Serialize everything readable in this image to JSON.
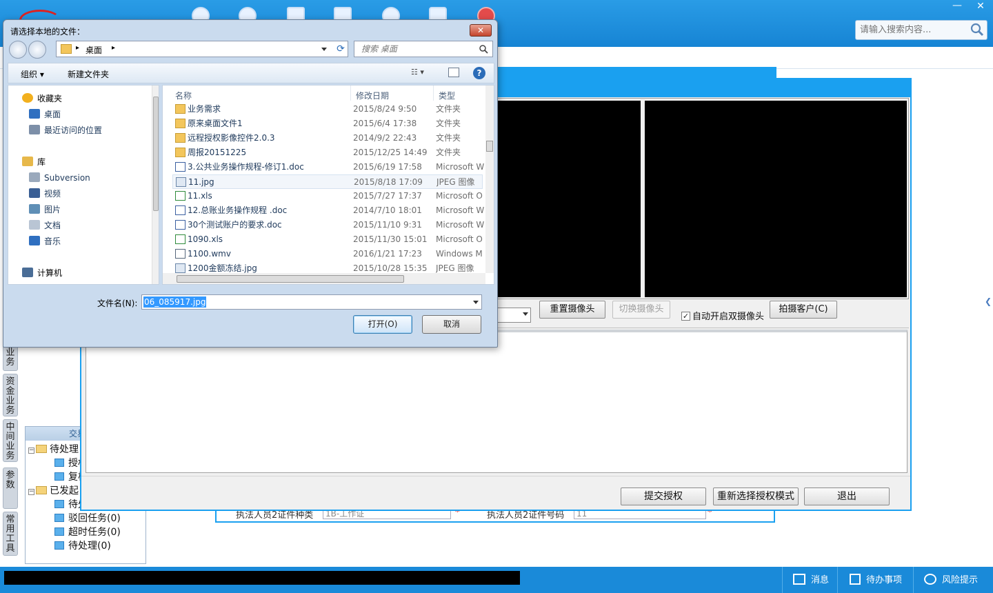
{
  "app": {
    "title_text": "",
    "search_placeholder": "请输入搜索内容...",
    "minimize_glyph": "—",
    "close_glyph": "✕",
    "vertical_tabs": [
      {
        "id": "business",
        "chars": [
          "业",
          "务"
        ]
      },
      {
        "id": "funds",
        "chars": [
          "资",
          "金",
          "业",
          "务"
        ]
      },
      {
        "id": "intermediary",
        "chars": [
          "中",
          "间",
          "业",
          "务"
        ]
      },
      {
        "id": "params",
        "chars": [
          "参",
          "数"
        ]
      },
      {
        "id": "tools",
        "chars": [
          "常",
          "用",
          "工",
          "具"
        ]
      }
    ],
    "trade_panel": {
      "title": "交易信息",
      "tree": [
        {
          "label": "待处理",
          "level": 0,
          "expander": "−"
        },
        {
          "label": "授权",
          "level": 1
        },
        {
          "label": "复核",
          "level": 1
        },
        {
          "label": "已发起",
          "level": 0,
          "expander": "−"
        },
        {
          "label": "待处理",
          "level": 1
        },
        {
          "label": "驳回任务(0)",
          "level": 1
        },
        {
          "label": "超时任务(0)",
          "level": 1
        },
        {
          "label": "待处理(0)",
          "level": 1
        }
      ]
    },
    "bg_form": {
      "field1_label": "执法人员2证件种类",
      "field1_value": "1B-工作证",
      "field2_label": "执法人员2证件号码",
      "field2_value": "11",
      "required_mark": "*"
    },
    "status_bar": {
      "messages": "消息",
      "todo": "待办事项",
      "risk": "风险提示"
    }
  },
  "auth_window": {
    "reset_camera": "重置摄像头",
    "switch_camera": "切换摄像头",
    "auto_dual_camera": "自动开启双摄像头",
    "auto_dual_checked": "✓",
    "capture_customer": "拍摄客户(C)",
    "submit": "提交授权",
    "reselect_mode": "重新选择授权模式",
    "exit": "退出"
  },
  "file_dialog": {
    "title": "请选择本地的文件：",
    "close_glyph": "✕",
    "address": "桌面",
    "address_sep": "▸",
    "refresh_glyph": "⟳",
    "search_placeholder": "搜索 桌面",
    "toolbar": {
      "organize": "组织 ▾",
      "new_folder": "新建文件夹",
      "views_glyph": "☷ ▾",
      "help_glyph": "?"
    },
    "nav": [
      {
        "label": "收藏夹",
        "group": true,
        "icon": "star-icon",
        "color": "#f2b01e"
      },
      {
        "label": "桌面",
        "group": false,
        "icon": "desktop-icon",
        "color": "#2f6fc0"
      },
      {
        "label": "最近访问的位置",
        "group": false,
        "icon": "recent-places-icon",
        "color": "#7d8fa8"
      },
      {
        "label": "库",
        "group": true,
        "icon": "library-icon",
        "color": "#e7b84a"
      },
      {
        "label": "Subversion",
        "group": false,
        "icon": "subversion-icon",
        "color": "#9aa9bc"
      },
      {
        "label": "视频",
        "group": false,
        "icon": "video-icon",
        "color": "#3a5f95"
      },
      {
        "label": "图片",
        "group": false,
        "icon": "pictures-icon",
        "color": "#5f8fb6"
      },
      {
        "label": "文档",
        "group": false,
        "icon": "documents-icon",
        "color": "#b9c5d4"
      },
      {
        "label": "音乐",
        "group": false,
        "icon": "music-icon",
        "color": "#2f6fc0"
      },
      {
        "label": "计算机",
        "group": true,
        "icon": "computer-icon",
        "color": "#4a6d96"
      }
    ],
    "columns": {
      "name": "名称",
      "date": "修改日期",
      "type": "类型"
    },
    "files": [
      {
        "name": "业务需求",
        "date": "2015/8/24 9:50",
        "type": "文件夹",
        "kind": "folder"
      },
      {
        "name": "原来桌面文件1",
        "date": "2015/6/4 17:38",
        "type": "文件夹",
        "kind": "folder"
      },
      {
        "name": "远程授权影像控件2.0.3",
        "date": "2014/9/2 22:43",
        "type": "文件夹",
        "kind": "folder"
      },
      {
        "name": "周报20151225",
        "date": "2015/12/25 14:49",
        "type": "文件夹",
        "kind": "folder"
      },
      {
        "name": "3.公共业务操作规程-修订1.doc",
        "date": "2015/6/19 17:58",
        "type": "Microsoft W",
        "kind": "doc"
      },
      {
        "name": "11.jpg",
        "date": "2015/8/18 17:09",
        "type": "JPEG 图像",
        "kind": "jpg"
      },
      {
        "name": "11.xls",
        "date": "2015/7/27 17:37",
        "type": "Microsoft O",
        "kind": "xls"
      },
      {
        "name": "12.总账业务操作规程 .doc",
        "date": "2014/7/10 18:01",
        "type": "Microsoft W",
        "kind": "doc"
      },
      {
        "name": "30个测试账户的要求.doc",
        "date": "2015/11/10 9:31",
        "type": "Microsoft W",
        "kind": "doc"
      },
      {
        "name": "1090.xls",
        "date": "2015/11/30 15:01",
        "type": "Microsoft O",
        "kind": "xls"
      },
      {
        "name": "1100.wmv",
        "date": "2016/1/21 17:23",
        "type": "Windows M",
        "kind": "wmv"
      },
      {
        "name": "1200金额冻结.jpg",
        "date": "2015/10/28 15:35",
        "type": "JPEG 图像",
        "kind": "jpg"
      }
    ],
    "filename_label": "文件名(N):",
    "filename_value": "06_085917.jpg",
    "open_button": "打开(O)",
    "cancel_button": "取消"
  }
}
